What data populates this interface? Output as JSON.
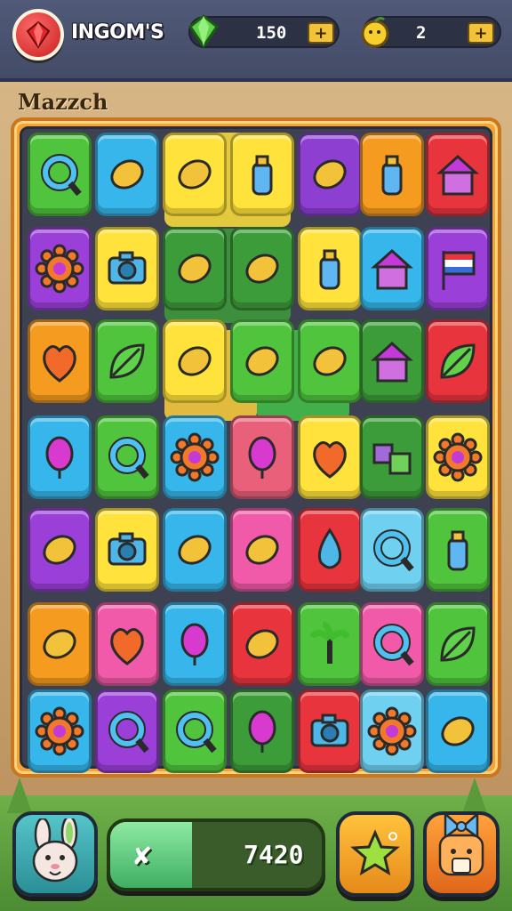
{
  "header": {
    "title": "INGOM'S",
    "gems": {
      "value": "150",
      "add_label": "+"
    },
    "coins": {
      "value": "2",
      "add_label": "+"
    }
  },
  "board": {
    "title": "Mazzch",
    "rows": [
      [
        {
          "color": "#4fc43c",
          "icon": "gold-ring-icon"
        },
        {
          "color": "#36b6ea",
          "icon": "red-x-pin-icon"
        },
        {
          "color": "#ffe23b",
          "icon": "sign-card-icon"
        },
        {
          "color": "#ffe23b",
          "icon": "battery-icon"
        },
        {
          "color": "#8c3fd0",
          "icon": "popsicle-icon"
        },
        {
          "color": "#f59b1f",
          "icon": "potion-bottle-icon"
        },
        {
          "color": "#e8353d",
          "icon": "castle-tower-icon"
        }
      ],
      [
        {
          "color": "#9a3fd8",
          "icon": "sun-gear-icon"
        },
        {
          "color": "#ffe23b",
          "icon": "camera-icon"
        },
        {
          "color": "#3d9c3a",
          "icon": "robot-figure-icon"
        },
        {
          "color": "#3d9c3a",
          "icon": "rainbow-arc-icon"
        },
        {
          "color": "#ffe23b",
          "icon": "jar-icon"
        },
        {
          "color": "#36b6ea",
          "icon": "tent-icon"
        },
        {
          "color": "#9a3fd8",
          "icon": "flag-icon"
        }
      ],
      [
        {
          "color": "#f59b1f",
          "icon": "lemon-icon"
        },
        {
          "color": "#4fc43c",
          "icon": "green-kite-icon"
        },
        {
          "color": "#ffe23b",
          "icon": "pink-bubble-icon"
        },
        {
          "color": "#4fc43c",
          "icon": "green-stick-icon"
        },
        {
          "color": "#4fc43c",
          "icon": "lollipop-icon"
        },
        {
          "color": "#3d9c3a",
          "icon": "house-icon"
        },
        {
          "color": "#e8353d",
          "icon": "leaf-icon"
        }
      ],
      [
        {
          "color": "#36b6ea",
          "icon": "balloon-icon"
        },
        {
          "color": "#4fc43c",
          "icon": "magnifier-icon"
        },
        {
          "color": "#36b6ea",
          "icon": "orange-gear-icon"
        },
        {
          "color": "#e8607a",
          "icon": "purple-balloon-icon"
        },
        {
          "color": "#ffe23b",
          "icon": "heart-pin-icon"
        },
        {
          "color": "#3d9c3a",
          "icon": "cubes-icon"
        },
        {
          "color": "#ffe23b",
          "icon": "flower-gear-icon"
        }
      ],
      [
        {
          "color": "#9a3fd8",
          "icon": "candy-icon"
        },
        {
          "color": "#ffe23b",
          "icon": "photo-camera-icon"
        },
        {
          "color": "#36b6ea",
          "icon": "rocket-icon"
        },
        {
          "color": "#f05aa8",
          "icon": "flashlight-icon"
        },
        {
          "color": "#e8353d",
          "icon": "water-drop-icon"
        },
        {
          "color": "#6fd0f0",
          "icon": "search-lens-icon"
        },
        {
          "color": "#4fc43c",
          "icon": "jar-bottle-icon"
        }
      ],
      [
        {
          "color": "#f59b1f",
          "icon": "bird-icon"
        },
        {
          "color": "#f05aa8",
          "icon": "apple-icon"
        },
        {
          "color": "#36b6ea",
          "icon": "magenta-balloon-icon"
        },
        {
          "color": "#e8353d",
          "icon": "bear-icon"
        },
        {
          "color": "#4fc43c",
          "icon": "palm-tree-icon"
        },
        {
          "color": "#f05aa8",
          "icon": "ring-icon"
        },
        {
          "color": "#4fc43c",
          "icon": "star-kite-icon"
        }
      ],
      [
        {
          "color": "#36b6ea",
          "icon": "orange-gear-icon"
        },
        {
          "color": "#9a3fd8",
          "icon": "mirror-icon"
        },
        {
          "color": "#4fc43c",
          "icon": "blue-ring-icon"
        },
        {
          "color": "#3d9c3a",
          "icon": "red-balloon-icon"
        },
        {
          "color": "#e8353d",
          "icon": "camera-icon"
        },
        {
          "color": "#6fd0f0",
          "icon": "sun-icon"
        },
        {
          "color": "#36b6ea",
          "icon": "flower-pin-icon"
        }
      ]
    ]
  },
  "footer": {
    "score": "7420",
    "score_progress": 0.35,
    "left_character": "bunny-icon",
    "right_character": "cat-bow-icon",
    "star_button": "star-icon"
  }
}
